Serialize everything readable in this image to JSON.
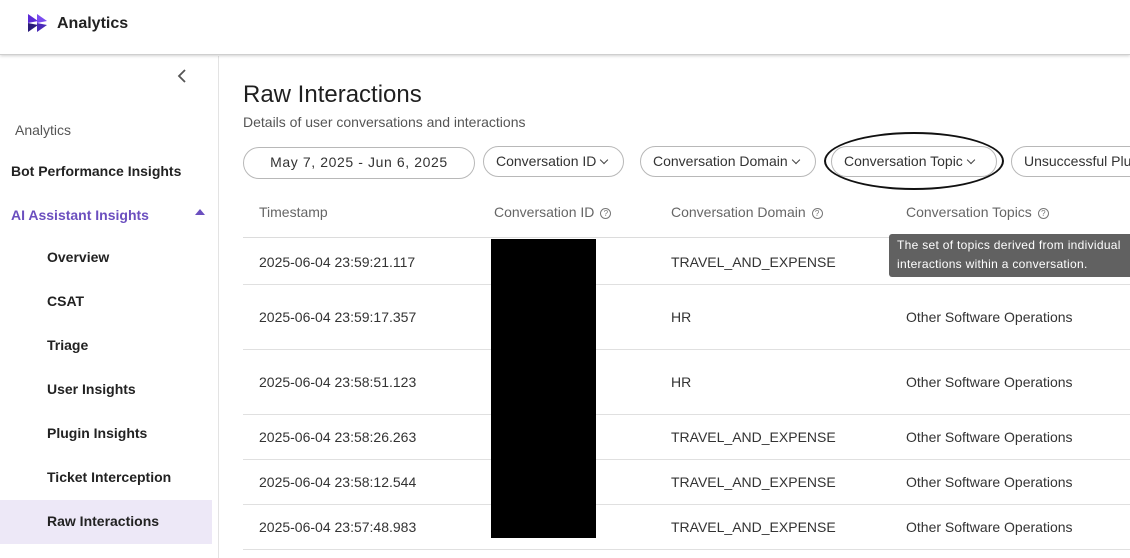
{
  "header": {
    "app_title": "Analytics",
    "logo_icon": "analytics-logo-icon",
    "logo_color": "#5b2ad6"
  },
  "sidebar": {
    "collapse_icon": "chevron-left-icon",
    "section_label": "Analytics",
    "bot_performance": "Bot Performance Insights",
    "ai_assistant": "AI Assistant Insights",
    "accent_color": "#6b4fbf",
    "items": [
      {
        "label": "Overview"
      },
      {
        "label": "CSAT"
      },
      {
        "label": "Triage"
      },
      {
        "label": "User Insights"
      },
      {
        "label": "Plugin Insights"
      },
      {
        "label": "Ticket Interception"
      },
      {
        "label": "Raw Interactions"
      }
    ],
    "active_item": "Raw Interactions"
  },
  "main": {
    "title": "Raw Interactions",
    "subtitle": "Details of user conversations and interactions",
    "filters": {
      "date_range": "May 7, 2025 - Jun 6, 2025",
      "conversation_id": "Conversation ID",
      "conversation_domain": "Conversation Domain",
      "conversation_topic": "Conversation Topic",
      "unsuccessful": "Unsuccessful Plu"
    },
    "table": {
      "columns": [
        "Timestamp",
        "Conversation ID",
        "Conversation Domain",
        "Conversation Topics"
      ],
      "help_glyph": "?",
      "rows": [
        {
          "timestamp": "2025-06-04 23:59:21.117",
          "domain": "TRAVEL_AND_EXPENSE",
          "topics": ""
        },
        {
          "timestamp": "2025-06-04 23:59:17.357",
          "domain": "HR",
          "topics": "Other Software Operations"
        },
        {
          "timestamp": "2025-06-04 23:58:51.123",
          "domain": "HR",
          "topics": "Other Software Operations"
        },
        {
          "timestamp": "2025-06-04 23:58:26.263",
          "domain": "TRAVEL_AND_EXPENSE",
          "topics": "Other Software Operations"
        },
        {
          "timestamp": "2025-06-04 23:58:12.544",
          "domain": "TRAVEL_AND_EXPENSE",
          "topics": "Other Software Operations"
        },
        {
          "timestamp": "2025-06-04 23:57:48.983",
          "domain": "TRAVEL_AND_EXPENSE",
          "topics": "Other Software Operations"
        }
      ]
    },
    "tooltip": {
      "line1": "The set of topics derived from individual",
      "line2": "interactions within a conversation."
    }
  }
}
